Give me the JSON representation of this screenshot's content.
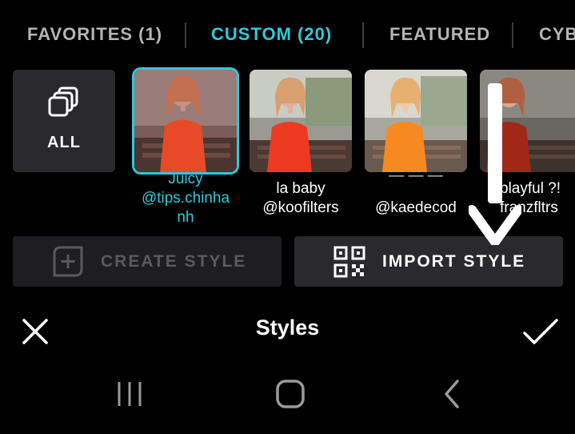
{
  "tabs": [
    {
      "label": "FAVORITES (1)",
      "active": false
    },
    {
      "label": "CUSTOM (20)",
      "active": true
    },
    {
      "label": "FEATURED",
      "active": false
    },
    {
      "label": "CYB",
      "active": false
    }
  ],
  "all_tile": {
    "label": "ALL",
    "icon": "copy-stack-icon"
  },
  "styles": [
    {
      "caption_lines": [
        "Juicy",
        "@tips.chinha",
        "nh"
      ],
      "selected": true
    },
    {
      "caption_lines": [
        "la baby",
        "@koofilters"
      ],
      "selected": false
    },
    {
      "caption_lines": [
        "@kaedecod"
      ],
      "selected": false
    },
    {
      "caption_lines": [
        "playful ?!",
        "franzfltrs"
      ],
      "selected": false
    }
  ],
  "buttons": {
    "create": {
      "label": "CREATE STYLE",
      "icon": "add-square-icon",
      "enabled": false
    },
    "import": {
      "label": "IMPORT STYLE",
      "icon": "qr-code-icon",
      "enabled": true
    }
  },
  "bottom_bar": {
    "title": "Styles",
    "close_icon": "close-icon",
    "confirm_icon": "checkmark-icon"
  },
  "system_nav": {
    "recents_icon": "recents-icon",
    "home_icon": "home-icon",
    "back_icon": "back-icon"
  },
  "colors": {
    "accent": "#2ec9d9",
    "background": "#000000",
    "tile": "#2a2a2c",
    "inactive_text": "#b4b4b4",
    "disabled_text": "#5a5a5c"
  }
}
